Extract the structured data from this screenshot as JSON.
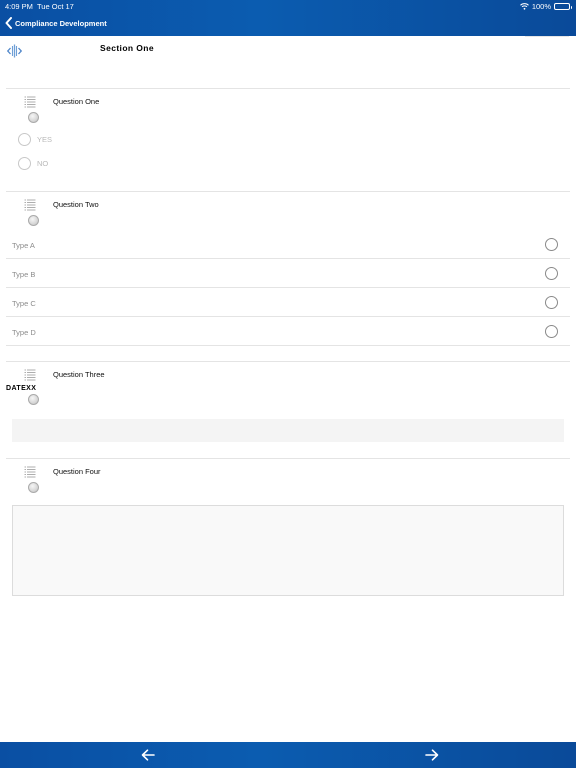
{
  "status_bar": {
    "time": "4:09 PM",
    "date": "Tue Oct 17",
    "battery": "100%"
  },
  "nav": {
    "back_title": "Compliance Development"
  },
  "section": {
    "title": "Section One"
  },
  "questions": [
    {
      "label": "Question One",
      "options": [
        "YES",
        "NO"
      ]
    },
    {
      "label": "Question Two",
      "types": [
        "Type A",
        "Type B",
        "Type C",
        "Type D"
      ]
    },
    {
      "label": "Question Three",
      "tag": "DATEXX"
    },
    {
      "label": "Question Four"
    }
  ],
  "colors": {
    "bar_blue": "#0b5cb0",
    "divider": "#e4e4e4",
    "field_bg": "#f4f4f4"
  },
  "icons": [
    "chevron-left-icon",
    "wifi-icon",
    "battery-icon",
    "section-expand-icon",
    "list-icon",
    "arrow-left-icon",
    "arrow-right-icon"
  ]
}
